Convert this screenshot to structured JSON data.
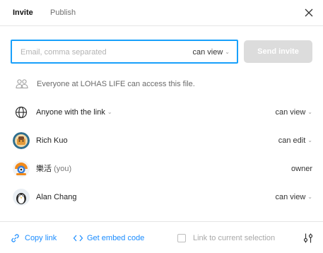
{
  "tabs": {
    "invite": "Invite",
    "publish": "Publish"
  },
  "invite": {
    "placeholder": "Email, comma separated",
    "permission": "can view",
    "send_label": "Send invite"
  },
  "org_access": {
    "text": "Everyone at LOHAS LIFE can access this file."
  },
  "rows": [
    {
      "name": "Anyone with the link",
      "permission": "can view",
      "icon": "globe-icon"
    },
    {
      "name": "Rich Kuo",
      "permission": "can edit",
      "icon": "avatar-rich-kuo"
    },
    {
      "name": "樂活",
      "suffix": "(you)",
      "permission": "owner",
      "icon": "avatar-lohas"
    },
    {
      "name": "Alan Chang",
      "permission": "can view",
      "icon": "avatar-alan-chang"
    }
  ],
  "footer": {
    "copy_link": "Copy link",
    "embed_code": "Get embed code",
    "link_selection": "Link to current selection"
  },
  "colors": {
    "accent": "#18a0fb",
    "link": "#1a8cff",
    "disabled_button": "#dcdcdc"
  }
}
